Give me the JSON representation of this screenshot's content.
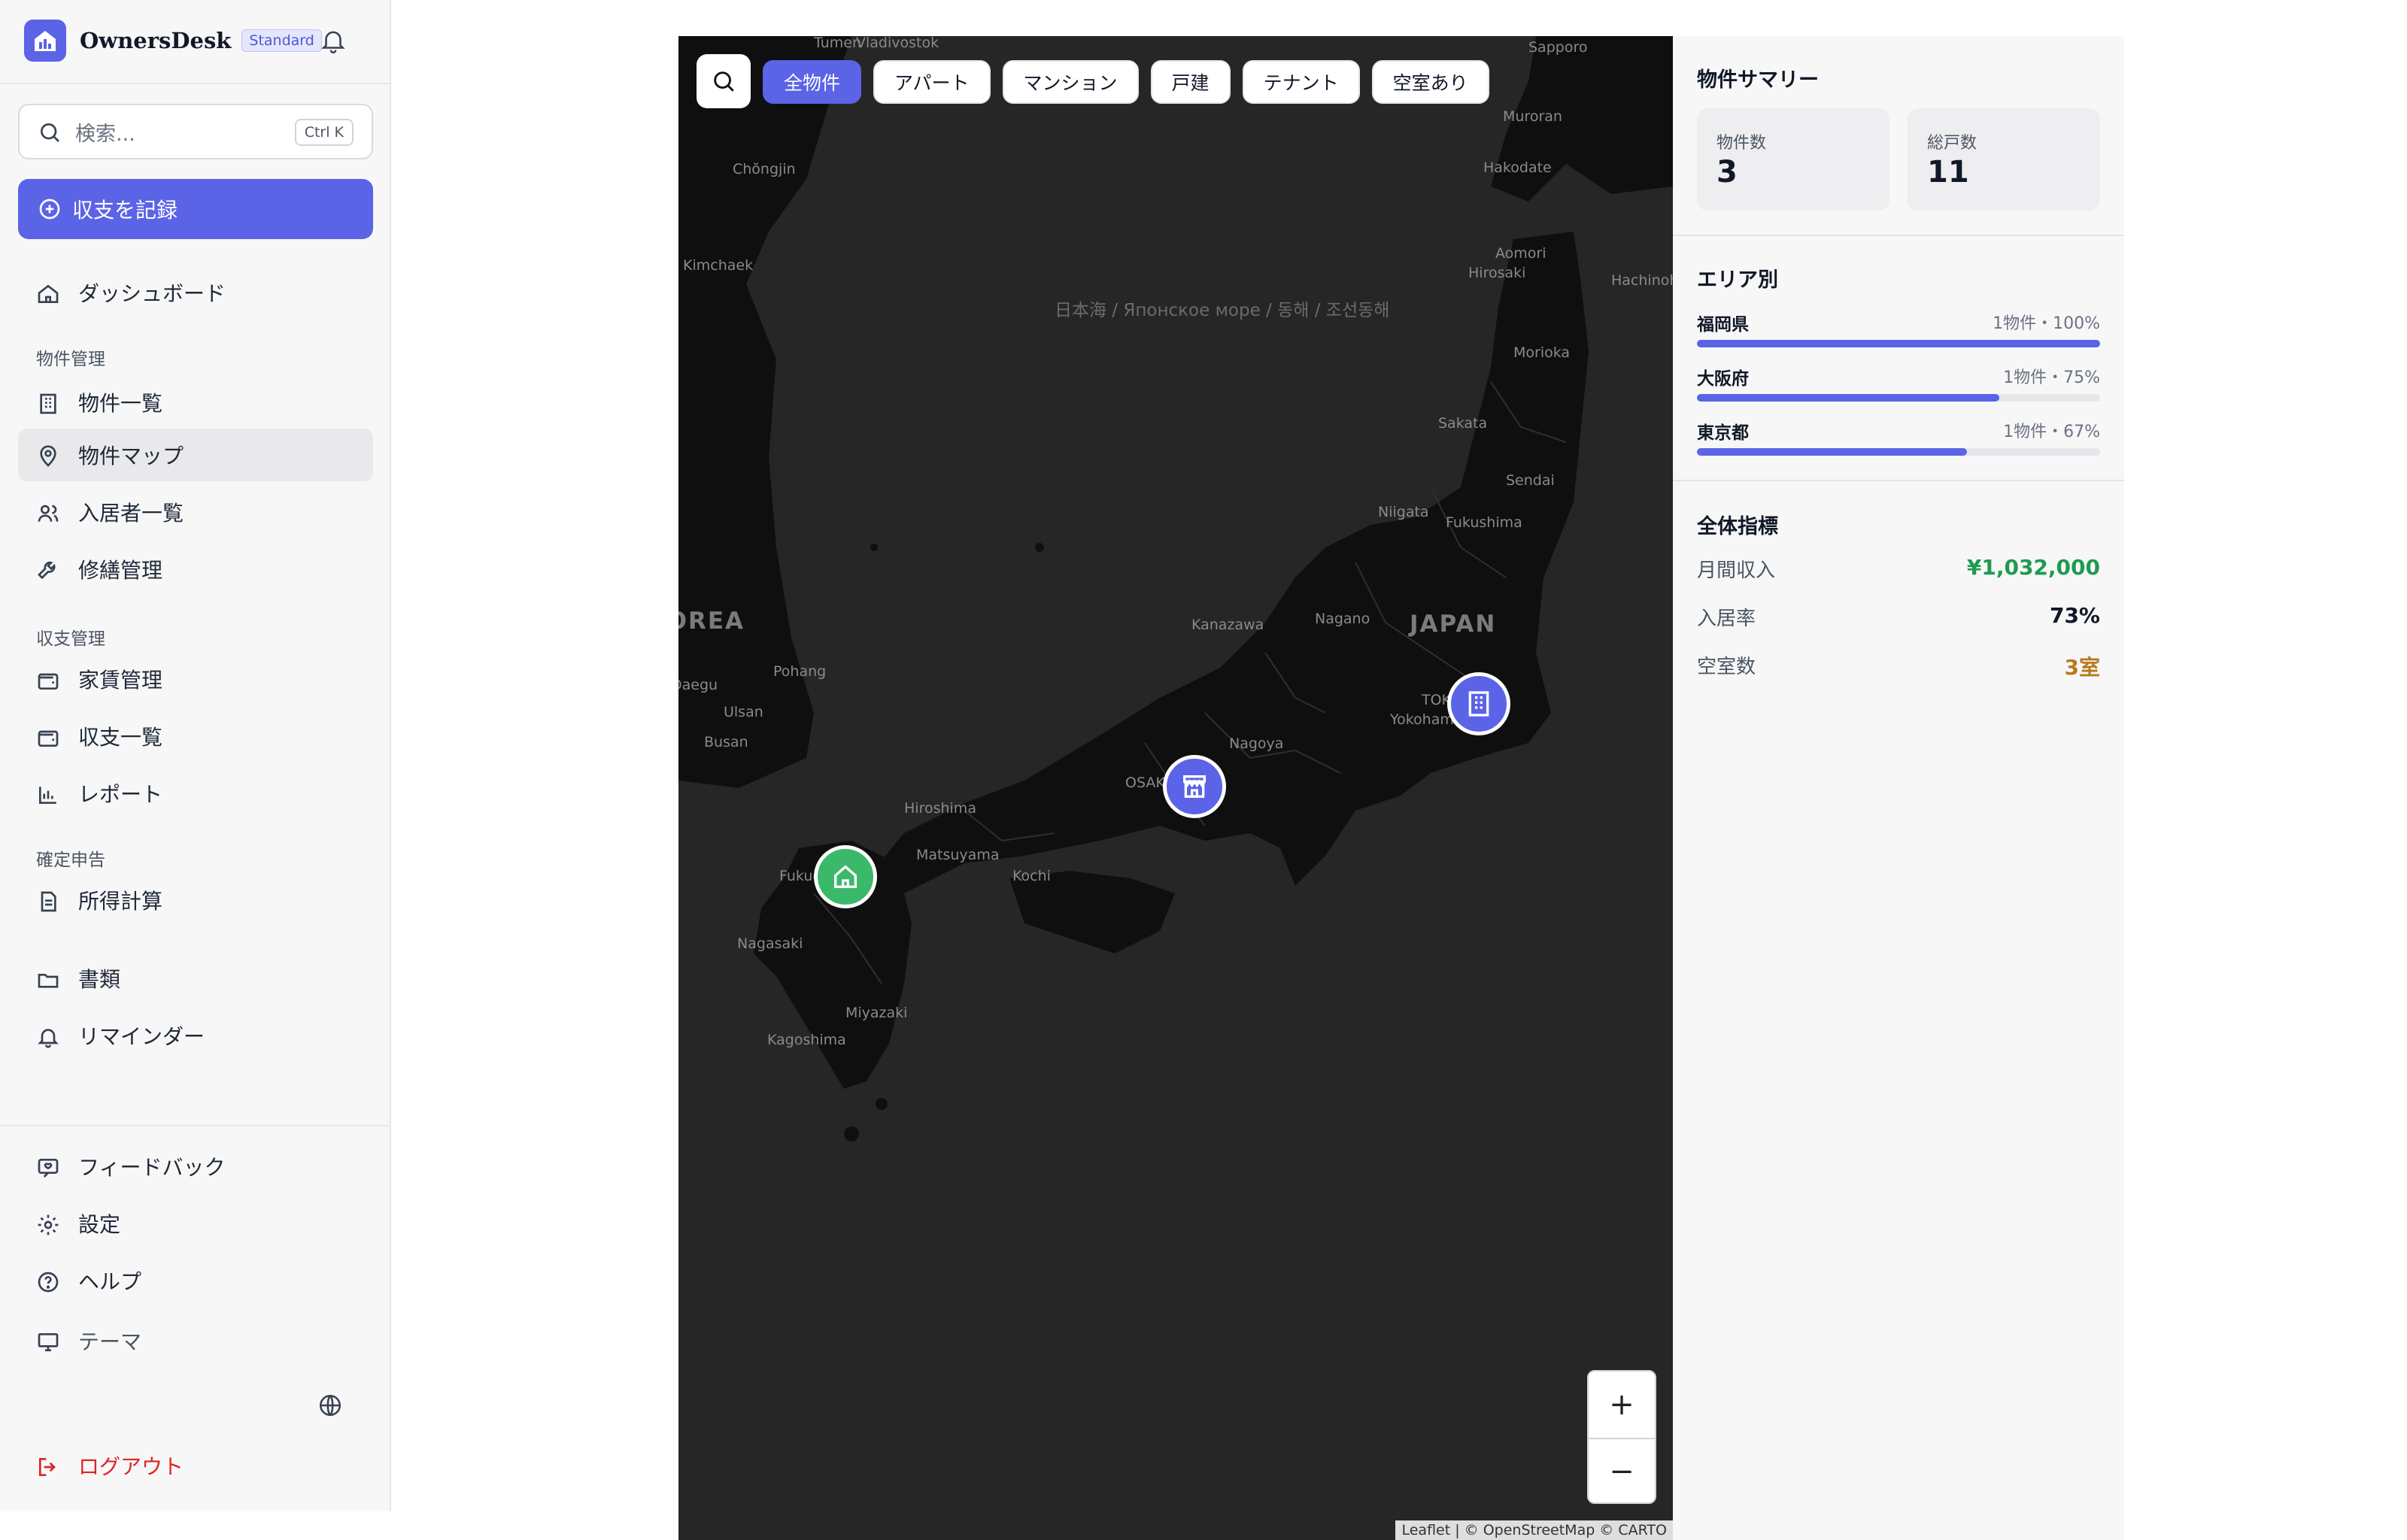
{
  "app": {
    "name": "OwnersDesk",
    "plan": "Standard"
  },
  "search": {
    "placeholder": "検索...",
    "shortcut": "Ctrl K"
  },
  "record_button": "収支を記録",
  "nav": {
    "dashboard": "ダッシュボード",
    "section_property": "物件管理",
    "property_list": "物件一覧",
    "property_map": "物件マップ",
    "tenant_list": "入居者一覧",
    "repair": "修繕管理",
    "section_finance": "収支管理",
    "rent": "家賃管理",
    "income_list": "収支一覧",
    "report": "レポート",
    "section_tax": "確定申告",
    "income_calc": "所得計算",
    "documents": "書類",
    "reminder": "リマインダー",
    "feedback": "フィードバック",
    "settings": "設定",
    "help": "ヘルプ",
    "theme": "テーマ",
    "logout": "ログアウト"
  },
  "map": {
    "filters": [
      "全物件",
      "アパート",
      "マンション",
      "戸建",
      "テナント",
      "空室あり"
    ],
    "active_filter": "全物件",
    "zoom_in": "+",
    "zoom_out": "−",
    "attribution": "Leaflet | © OpenStreetMap © CARTO",
    "labels": {
      "vladivostok": "Vladivostok",
      "tumen": "Tumen",
      "sapporo": "Sapporo",
      "muroran": "Muroran",
      "chongjin": "Chŏngjin",
      "hakodate": "Hakodate",
      "kimchaek": "Kimchaek",
      "aomori": "Aomori",
      "hirosaki": "Hirosaki",
      "hachinohe": "Hachinohe",
      "sea": "日本海 / Японское море / 동해 / 조선동해",
      "morioka": "Morioka",
      "sakata": "Sakata",
      "sendai": "Sendai",
      "niigata": "Niigata",
      "fukushima": "Fukushima",
      "korea": "KOREA",
      "kanazawa": "Kanazawa",
      "nagano": "Nagano",
      "japan": "JAPAN",
      "pohang": "Pohang",
      "daegu": "Daegu",
      "ulsan": "Ulsan",
      "tokyo": "TOKYO",
      "yokohama": "Yokohama",
      "busan": "Busan",
      "nagoya": "Nagoya",
      "osaka": "OSAKA",
      "hiroshima": "Hiroshima",
      "matsuyama": "Matsuyama",
      "kochi": "Kochi",
      "fukuoka": "Fukuoka",
      "nagasaki": "Nagasaki",
      "miyazaki": "Miyazaki",
      "kagoshima": "Kagoshima"
    },
    "pins": [
      {
        "name": "fukuoka-house",
        "icon": "house-icon",
        "color": "#3bb96a"
      },
      {
        "name": "osaka-tenant",
        "icon": "store-icon",
        "color": "#5b63e6"
      },
      {
        "name": "tokyo-building",
        "icon": "building-icon",
        "color": "#5b63e6"
      }
    ]
  },
  "summary": {
    "title": "物件サマリー",
    "property_count_label": "物件数",
    "property_count": "3",
    "unit_count_label": "総戸数",
    "unit_count": "11",
    "area_title": "エリア別",
    "areas": [
      {
        "name": "福岡県",
        "meta": "1物件・100%",
        "percent": 100
      },
      {
        "name": "大阪府",
        "meta": "1物件・75%",
        "percent": 75
      },
      {
        "name": "東京都",
        "meta": "1物件・67%",
        "percent": 67
      }
    ],
    "overall_title": "全体指標",
    "monthly_income_label": "月間収入",
    "monthly_income": "¥1,032,000",
    "occupancy_label": "入居率",
    "occupancy": "73%",
    "vacancy_label": "空室数",
    "vacancy": "3室"
  },
  "colors": {
    "accent": "#5b63e6",
    "income": "#1f9a4e",
    "vacancy": "#b7791f",
    "logout": "#dc2626"
  }
}
